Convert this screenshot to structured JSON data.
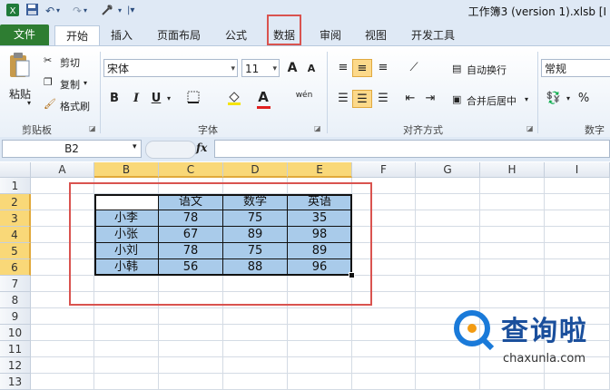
{
  "window": {
    "title": "工作簿3 (version 1).xlsb [Ⅰ"
  },
  "qat": {
    "undo_arrow": "↶",
    "redo_arrow": "↷",
    "more": "▾"
  },
  "tabs": [
    {
      "label": "文件"
    },
    {
      "label": "开始"
    },
    {
      "label": "插入"
    },
    {
      "label": "页面布局"
    },
    {
      "label": "公式"
    },
    {
      "label": "数据"
    },
    {
      "label": "审阅"
    },
    {
      "label": "视图"
    },
    {
      "label": "开发工具"
    }
  ],
  "ribbon": {
    "clipboard": {
      "paste": "粘贴",
      "cut": "剪切",
      "copy": "复制",
      "format_painter": "格式刷",
      "group": "剪贴板"
    },
    "font": {
      "name": "宋体",
      "size": "11",
      "grow": "A",
      "shrink": "A",
      "bold": "B",
      "italic": "I",
      "underline": "U",
      "color_letter": "A",
      "phonetic": "wén",
      "group": "字体"
    },
    "align": {
      "wrap": "自动换行",
      "merge": "合并后居中",
      "group": "对齐方式"
    },
    "number": {
      "format": "常规",
      "percent": "%",
      "group": "数字"
    }
  },
  "formula_bar": {
    "name_box": "B2",
    "fx": "fx"
  },
  "sheet": {
    "columns": [
      "A",
      "B",
      "C",
      "D",
      "E",
      "F",
      "G",
      "H",
      "I"
    ],
    "rows": [
      "1",
      "2",
      "3",
      "4",
      "5",
      "6",
      "7",
      "8",
      "9",
      "10",
      "11",
      "12",
      "13"
    ],
    "table": {
      "headers": [
        "",
        "语文",
        "数学",
        "英语"
      ],
      "rows": [
        [
          "小李",
          "78",
          "75",
          "35"
        ],
        [
          "小张",
          "67",
          "89",
          "98"
        ],
        [
          "小刘",
          "78",
          "75",
          "89"
        ],
        [
          "小韩",
          "56",
          "88",
          "96"
        ]
      ]
    },
    "selected_cols": [
      "B",
      "C",
      "D",
      "E"
    ],
    "selected_rows": [
      "2",
      "3",
      "4",
      "5",
      "6"
    ]
  },
  "watermark": {
    "name": "查询啦",
    "url": "chaxunla.com"
  },
  "colors": {
    "accent_red": "#d9534f",
    "selection": "#a9cbea",
    "file_tab": "#2e7d32"
  }
}
